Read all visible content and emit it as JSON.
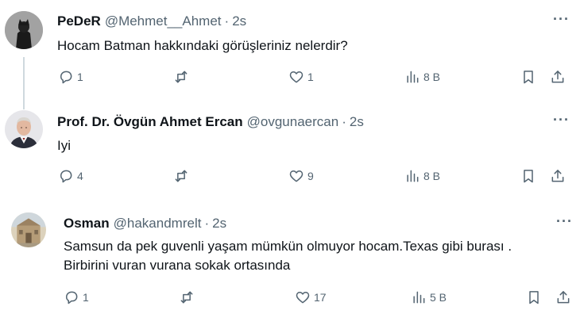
{
  "posts": [
    {
      "name": "PeDeR",
      "handle": "@Mehmet__Ahmet",
      "dot": "·",
      "time": "2s",
      "more": "···",
      "lines": [
        "Hocam Batman hakkındaki görüşleriniz nelerdir?"
      ],
      "replies": "1",
      "reposts": "",
      "likes": "1",
      "views": "8 B"
    },
    {
      "name": "Prof. Dr. Övgün Ahmet Ercan",
      "handle": "@ovgunaercan",
      "dot": "·",
      "time": "2s",
      "more": "···",
      "lines": [
        "Iyi"
      ],
      "replies": "4",
      "reposts": "",
      "likes": "9",
      "views": "8 B"
    },
    {
      "name": "Osman",
      "handle": "@hakandmrelt",
      "dot": "·",
      "time": "2s",
      "more": "···",
      "lines": [
        "Samsun da pek guvenli yaşam mümkün olmuyor hocam.Texas gibi burası .",
        "Birbirini vuran vurana sokak ortasında"
      ],
      "replies": "1",
      "reposts": "",
      "likes": "17",
      "views": "5 B"
    }
  ]
}
